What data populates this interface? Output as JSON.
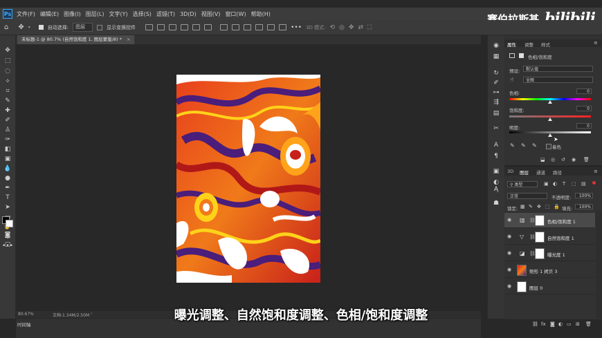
{
  "app": {
    "logo": "Ps"
  },
  "brand": {
    "channel": "赛伯拉斯基",
    "site": "bilibili"
  },
  "menu": [
    "文件(F)",
    "编辑(E)",
    "图像(I)",
    "图层(L)",
    "文字(Y)",
    "选择(S)",
    "滤镜(T)",
    "3D(D)",
    "视图(V)",
    "窗口(W)",
    "帮助(H)"
  ],
  "options": {
    "auto_select_label": "自动选择:",
    "auto_select_value": "图层",
    "show_transform_label": "显示变换控件",
    "mode_3d": "3D 模式:"
  },
  "document": {
    "tab_title": "未标题-1 @ 80.7% (自然饱和度 1, 图层蒙版/8) *",
    "zoom": "80.67%",
    "doc_size": "文档:1.34M/2.50M"
  },
  "timeline_label": "时间轴",
  "subtitle": "曝光调整、自然饱和度调整、色相/饱和度调整",
  "properties": {
    "tabs": [
      "属性",
      "调整",
      "样式"
    ],
    "header": "色相/饱和度",
    "preset_label": "预设:",
    "preset_value": "默认值",
    "channel_value": "全图",
    "hue_label": "色相:",
    "hue_value": "0",
    "saturation_label": "饱和度:",
    "saturation_value": "0",
    "lightness_label": "明度:",
    "lightness_value": "0",
    "colorize_label": "着色"
  },
  "layers_panel": {
    "tabs": [
      "3D",
      "图层",
      "通道",
      "路径"
    ],
    "filter_label": "类型",
    "blend_mode": "正常",
    "opacity_label": "不透明度:",
    "opacity_value": "100%",
    "lock_label": "锁定:",
    "fill_label": "填充:",
    "fill_value": "100%",
    "layers": [
      {
        "name": "色相/饱和度 1",
        "kind": "adjustment",
        "icon": "hue-sat-icon",
        "selected": true
      },
      {
        "name": "自然饱和度 1",
        "kind": "adjustment",
        "icon": "vibrance-icon",
        "selected": false
      },
      {
        "name": "曝光度 1",
        "kind": "adjustment",
        "icon": "exposure-icon",
        "selected": false
      },
      {
        "name": "矩形 1 拷贝 3",
        "kind": "image",
        "icon": "image-thumb",
        "selected": false
      },
      {
        "name": "图层 0",
        "kind": "plain",
        "icon": "white-thumb",
        "selected": false
      }
    ]
  },
  "colors": {
    "accent_blue": "#3da8f5",
    "panel_bg": "#323232",
    "artwork_orange": "#f07a1a",
    "artwork_purple": "#4a1e7a",
    "artwork_red": "#d8241c"
  }
}
